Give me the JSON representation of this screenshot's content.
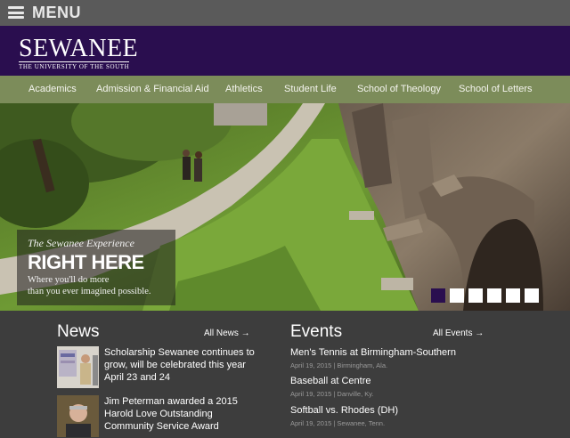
{
  "topbar": {
    "menu_label": "MENU"
  },
  "brand": {
    "logo_word": "SEWANEE",
    "logo_sub": "THE UNIVERSITY OF THE SOUTH",
    "color": "#2a0e4f"
  },
  "nav": {
    "items": [
      "Academics",
      "Admission & Financial Aid",
      "Athletics",
      "Student Life",
      "School of Theology",
      "School of Letters"
    ],
    "color": "#7c8c5a"
  },
  "hero": {
    "kicker": "The Sewanee Experience",
    "title": "RIGHT HERE",
    "body_line1": "Where you'll do more",
    "body_line2": "than you ever imagined possible.",
    "slide_count": 6,
    "active_slide": 1
  },
  "news": {
    "title": "News",
    "all_link": "All News →",
    "items": [
      {
        "text": "Scholarship Sewanee continues to grow, will be celebrated this year April 23 and 24"
      },
      {
        "text": "Jim Peterman awarded a 2015 Harold Love Outstanding Community Service Award"
      }
    ]
  },
  "events": {
    "title": "Events",
    "all_link": "All Events →",
    "items": [
      {
        "title": "Men's Tennis at Birmingham-Southern",
        "meta": "April 19, 2015 | Birmingham, Ala."
      },
      {
        "title": "Baseball at Centre",
        "meta": "April 19, 2015 | Danville, Ky."
      },
      {
        "title": "Softball vs. Rhodes (DH)",
        "meta": "April 19, 2015 | Sewanee, Tenn."
      }
    ]
  }
}
